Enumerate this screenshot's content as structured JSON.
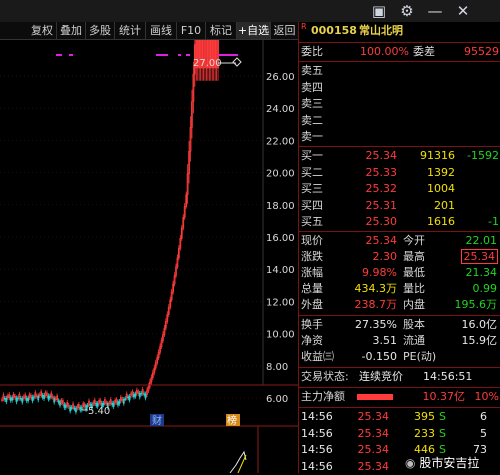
{
  "toolbar": {
    "buttons": [
      "复权",
      "叠加",
      "多股",
      "统计",
      "画线",
      "F10",
      "标记",
      "+自选",
      "返回"
    ]
  },
  "window_icons": [
    "window-icon",
    "gear-icon",
    "minimize-icon",
    "close-icon"
  ],
  "chart": {
    "y_ticks": [
      "26.00",
      "24.00",
      "22.00",
      "20.00",
      "18.00",
      "16.00",
      "14.00",
      "12.00",
      "10.00",
      "8.00",
      "6.00"
    ],
    "high_label": "27.00",
    "low_label": "5.40",
    "marker_cai": "财",
    "marker_bang": "榜"
  },
  "stock": {
    "flag": "R",
    "code": "000158",
    "name": "常山北明"
  },
  "weibi": {
    "label1": "委比",
    "value1": "100.00%",
    "label2": "委差",
    "value2": "95529"
  },
  "asks": [
    {
      "label": "卖五",
      "price": "",
      "vol": "",
      "chg": ""
    },
    {
      "label": "卖四",
      "price": "",
      "vol": "",
      "chg": ""
    },
    {
      "label": "卖三",
      "price": "",
      "vol": "",
      "chg": ""
    },
    {
      "label": "卖二",
      "price": "",
      "vol": "",
      "chg": ""
    },
    {
      "label": "卖一",
      "price": "",
      "vol": "",
      "chg": ""
    }
  ],
  "bids": [
    {
      "label": "买一",
      "price": "25.34",
      "vol": "91316",
      "chg": "-1592"
    },
    {
      "label": "买二",
      "price": "25.33",
      "vol": "1392",
      "chg": ""
    },
    {
      "label": "买三",
      "price": "25.32",
      "vol": "1004",
      "chg": ""
    },
    {
      "label": "买四",
      "price": "25.31",
      "vol": "201",
      "chg": ""
    },
    {
      "label": "买五",
      "price": "25.30",
      "vol": "1616",
      "chg": "-1"
    }
  ],
  "quote": {
    "xj_label": "现价",
    "xj": "25.34",
    "jk_label": "今开",
    "jk": "22.01",
    "zd_label": "涨跌",
    "zd": "2.30",
    "zg_label": "最高",
    "zg": "25.34",
    "zf_label": "涨幅",
    "zf": "9.98%",
    "zd2_label": "最低",
    "zd2": "21.34",
    "zl_label": "总量",
    "zl": "434.3万",
    "lb_label": "量比",
    "lb": "0.99",
    "wp_label": "外盘",
    "wp": "238.7万",
    "np_label": "内盘",
    "np": "195.6万"
  },
  "fundamentals": {
    "hs_label": "换手",
    "hs": "27.35%",
    "gb_label": "股本",
    "gb": "16.0亿",
    "jz_label": "净资",
    "jz": "3.51",
    "lt_label": "流通",
    "lt": "15.9亿",
    "sy_label": "收益㈢",
    "sy": "-0.150",
    "pe_label": "PE(动)",
    "pe": ""
  },
  "status": {
    "label": "交易状态:",
    "value": "连续竞价",
    "time": "14:56:51"
  },
  "mainflow": {
    "label": "主力净额",
    "value": "10.37亿",
    "pct": "10%"
  },
  "ticks": [
    {
      "time": "14:56",
      "price": "25.34",
      "vol": "395",
      "dir": "S",
      "n": "6"
    },
    {
      "time": "14:56",
      "price": "25.34",
      "vol": "233",
      "dir": "S",
      "n": "5"
    },
    {
      "time": "14:56",
      "price": "25.34",
      "vol": "446",
      "dir": "S",
      "n": "73"
    },
    {
      "time": "14:56",
      "price": "25.34",
      "vol": "",
      "dir": "",
      "n": ""
    }
  ],
  "watermark": "股市安吉拉",
  "colors": {
    "up": "#ff3b3b",
    "down": "#22d322",
    "accent": "#f2e100",
    "border": "#7a1212"
  }
}
